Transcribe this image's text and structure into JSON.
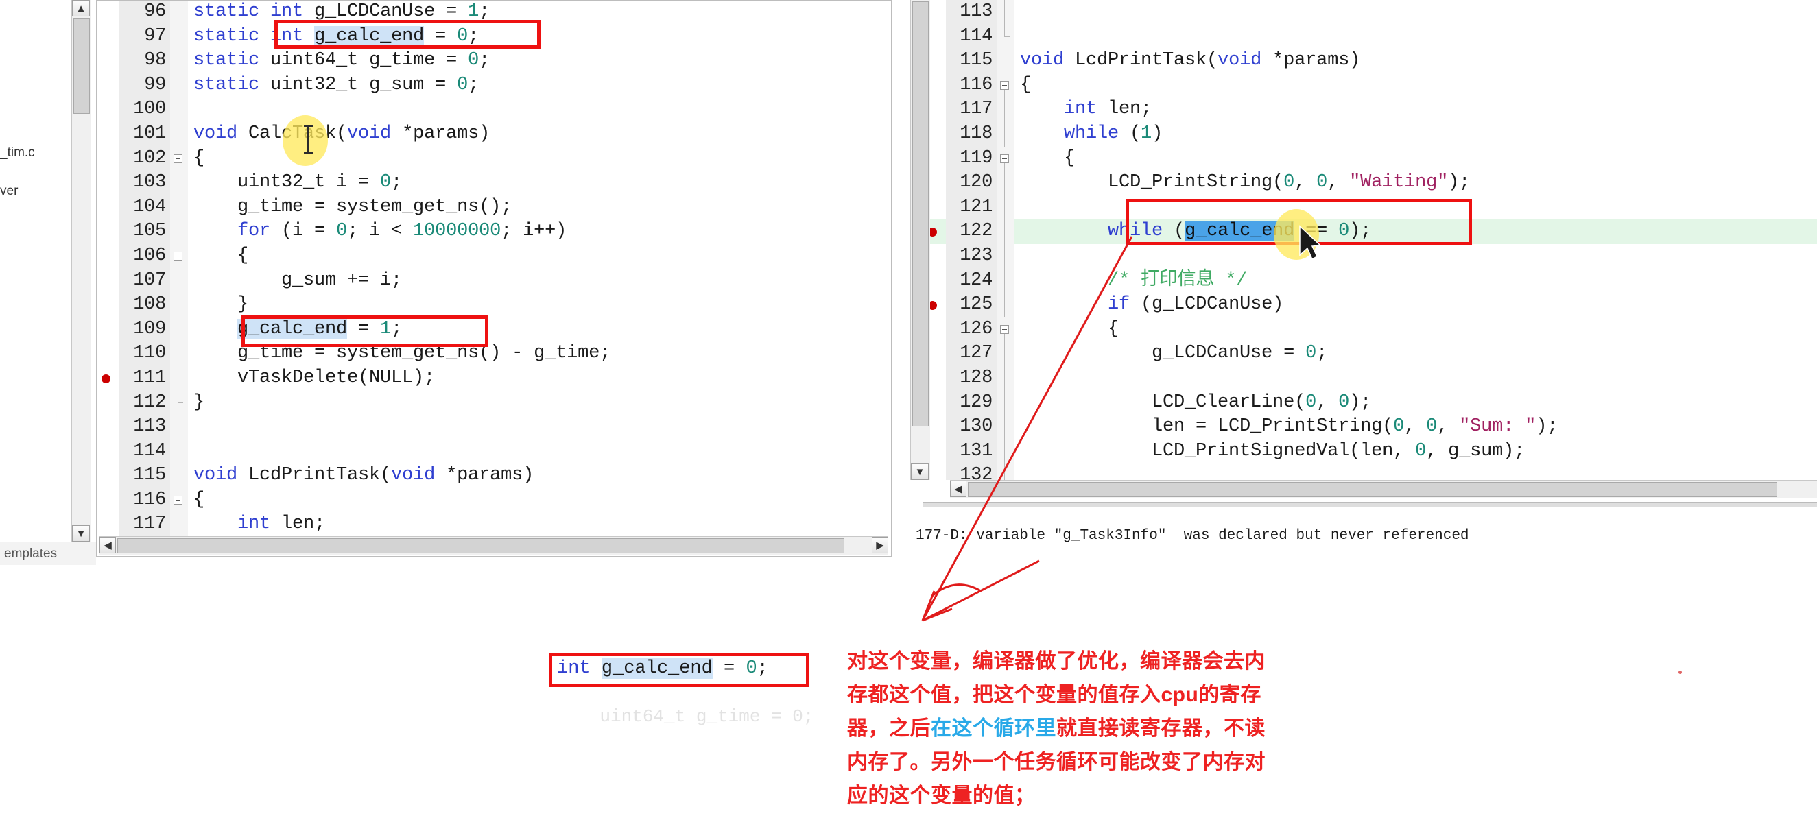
{
  "left_editor": {
    "name": "left-code-editor",
    "lines": [
      {
        "num": "96",
        "fold": "none",
        "bp": false,
        "exec": false,
        "tokens": [
          {
            "t": "static ",
            "c": "kw"
          },
          {
            "t": "int",
            "c": "type"
          },
          {
            "t": " g_LCDCanUse = ",
            "c": "fn"
          },
          {
            "t": "1",
            "c": "num"
          },
          {
            "t": ";",
            "c": "fn"
          }
        ]
      },
      {
        "num": "97",
        "fold": "none",
        "bp": false,
        "exec": false,
        "tokens": [
          {
            "t": "static ",
            "c": "kw"
          },
          {
            "t": "int",
            "c": "type"
          },
          {
            "t": " ",
            "c": "fn"
          },
          {
            "t": "g_calc_end",
            "c": "sel"
          },
          {
            "t": " = ",
            "c": "fn"
          },
          {
            "t": "0",
            "c": "num"
          },
          {
            "t": ";",
            "c": "fn"
          }
        ]
      },
      {
        "num": "98",
        "fold": "none",
        "bp": false,
        "exec": false,
        "tokens": [
          {
            "t": "static ",
            "c": "kw"
          },
          {
            "t": "uint64_t",
            "c": "fn"
          },
          {
            "t": " g_time = ",
            "c": "fn"
          },
          {
            "t": "0",
            "c": "num"
          },
          {
            "t": ";",
            "c": "fn"
          }
        ]
      },
      {
        "num": "99",
        "fold": "none",
        "bp": false,
        "exec": false,
        "tokens": [
          {
            "t": "static ",
            "c": "kw"
          },
          {
            "t": "uint32_t",
            "c": "fn"
          },
          {
            "t": " g_sum = ",
            "c": "fn"
          },
          {
            "t": "0",
            "c": "num"
          },
          {
            "t": ";",
            "c": "fn"
          }
        ]
      },
      {
        "num": "100",
        "fold": "none",
        "bp": false,
        "exec": false,
        "tokens": []
      },
      {
        "num": "101",
        "fold": "none",
        "bp": false,
        "exec": false,
        "tokens": [
          {
            "t": "void",
            "c": "kw"
          },
          {
            "t": " CalcTask(",
            "c": "fn"
          },
          {
            "t": "void",
            "c": "kw"
          },
          {
            "t": " *params)",
            "c": "fn"
          }
        ]
      },
      {
        "num": "102",
        "fold": "open",
        "bp": false,
        "exec": false,
        "tokens": [
          {
            "t": "{",
            "c": "fn"
          }
        ]
      },
      {
        "num": "103",
        "fold": "bar",
        "bp": false,
        "exec": false,
        "tokens": [
          {
            "t": "    uint32_t i = ",
            "c": "fn"
          },
          {
            "t": "0",
            "c": "num"
          },
          {
            "t": ";",
            "c": "fn"
          }
        ]
      },
      {
        "num": "104",
        "fold": "bar",
        "bp": false,
        "exec": false,
        "tokens": [
          {
            "t": "    g_time = system_get_ns();",
            "c": "fn"
          }
        ]
      },
      {
        "num": "105",
        "fold": "bar",
        "bp": false,
        "exec": false,
        "tokens": [
          {
            "t": "    ",
            "c": "fn"
          },
          {
            "t": "for",
            "c": "kw"
          },
          {
            "t": " (i = ",
            "c": "fn"
          },
          {
            "t": "0",
            "c": "num"
          },
          {
            "t": "; i < ",
            "c": "fn"
          },
          {
            "t": "10000000",
            "c": "num"
          },
          {
            "t": "; i++)",
            "c": "fn"
          }
        ]
      },
      {
        "num": "106",
        "fold": "open",
        "bp": false,
        "exec": false,
        "tokens": [
          {
            "t": "    {",
            "c": "fn"
          }
        ]
      },
      {
        "num": "107",
        "fold": "bar",
        "bp": false,
        "exec": false,
        "tokens": [
          {
            "t": "        g_sum += i;",
            "c": "fn"
          }
        ]
      },
      {
        "num": "108",
        "fold": "tick",
        "bp": false,
        "exec": false,
        "tokens": [
          {
            "t": "    }",
            "c": "fn"
          }
        ]
      },
      {
        "num": "109",
        "fold": "bar",
        "bp": false,
        "exec": false,
        "tokens": [
          {
            "t": "    ",
            "c": "fn"
          },
          {
            "t": "g_calc_end",
            "c": "sel"
          },
          {
            "t": " = ",
            "c": "fn"
          },
          {
            "t": "1",
            "c": "num"
          },
          {
            "t": ";",
            "c": "fn"
          }
        ]
      },
      {
        "num": "110",
        "fold": "bar",
        "bp": false,
        "exec": false,
        "tokens": [
          {
            "t": "    g_time = system_get_ns() - g_time;",
            "c": "fn"
          }
        ]
      },
      {
        "num": "111",
        "fold": "bar",
        "bp": true,
        "exec": false,
        "tokens": [
          {
            "t": "    vTaskDelete(NULL);",
            "c": "fn"
          }
        ]
      },
      {
        "num": "112",
        "fold": "end",
        "bp": false,
        "exec": false,
        "tokens": [
          {
            "t": "}",
            "c": "fn"
          }
        ]
      },
      {
        "num": "113",
        "fold": "none",
        "bp": false,
        "exec": false,
        "tokens": []
      },
      {
        "num": "114",
        "fold": "none",
        "bp": false,
        "exec": false,
        "tokens": []
      },
      {
        "num": "115",
        "fold": "none",
        "bp": false,
        "exec": false,
        "tokens": [
          {
            "t": "void",
            "c": "kw"
          },
          {
            "t": " LcdPrintTask(",
            "c": "fn"
          },
          {
            "t": "void",
            "c": "kw"
          },
          {
            "t": " *params)",
            "c": "fn"
          }
        ]
      },
      {
        "num": "116",
        "fold": "open",
        "bp": false,
        "exec": false,
        "tokens": [
          {
            "t": "{",
            "c": "fn"
          }
        ]
      },
      {
        "num": "117",
        "fold": "bar",
        "bp": false,
        "exec": false,
        "tokens": [
          {
            "t": "    ",
            "c": "fn"
          },
          {
            "t": "int",
            "c": "type"
          },
          {
            "t": " len;",
            "c": "fn"
          }
        ]
      }
    ]
  },
  "right_editor": {
    "name": "right-code-editor",
    "lines": [
      {
        "num": "113",
        "fold": "bar",
        "bp": false,
        "exec": false,
        "tokens": []
      },
      {
        "num": "114",
        "fold": "end",
        "bp": false,
        "exec": false,
        "tokens": []
      },
      {
        "num": "115",
        "fold": "none",
        "bp": false,
        "exec": false,
        "tokens": [
          {
            "t": "void",
            "c": "kw"
          },
          {
            "t": " LcdPrintTask(",
            "c": "fn"
          },
          {
            "t": "void",
            "c": "kw"
          },
          {
            "t": " *params)",
            "c": "fn"
          }
        ]
      },
      {
        "num": "116",
        "fold": "open",
        "bp": false,
        "exec": false,
        "tokens": [
          {
            "t": "{",
            "c": "fn"
          }
        ]
      },
      {
        "num": "117",
        "fold": "bar",
        "bp": false,
        "exec": false,
        "tokens": [
          {
            "t": "    ",
            "c": "fn"
          },
          {
            "t": "int",
            "c": "type"
          },
          {
            "t": " len;",
            "c": "fn"
          }
        ]
      },
      {
        "num": "118",
        "fold": "bar",
        "bp": false,
        "exec": false,
        "tokens": [
          {
            "t": "    ",
            "c": "fn"
          },
          {
            "t": "while",
            "c": "kw"
          },
          {
            "t": " (",
            "c": "fn"
          },
          {
            "t": "1",
            "c": "num"
          },
          {
            "t": ")",
            "c": "fn"
          }
        ]
      },
      {
        "num": "119",
        "fold": "open",
        "bp": false,
        "exec": false,
        "tokens": [
          {
            "t": "    {",
            "c": "fn"
          }
        ]
      },
      {
        "num": "120",
        "fold": "bar",
        "bp": false,
        "exec": false,
        "tokens": [
          {
            "t": "        LCD_PrintString(",
            "c": "fn"
          },
          {
            "t": "0",
            "c": "num"
          },
          {
            "t": ", ",
            "c": "fn"
          },
          {
            "t": "0",
            "c": "num"
          },
          {
            "t": ", ",
            "c": "fn"
          },
          {
            "t": "\"Waiting\"",
            "c": "str"
          },
          {
            "t": ");",
            "c": "fn"
          }
        ]
      },
      {
        "num": "121",
        "fold": "bar",
        "bp": false,
        "exec": false,
        "tokens": []
      },
      {
        "num": "122",
        "fold": "bar",
        "bp": true,
        "exec": true,
        "tokens": [
          {
            "t": "        ",
            "c": "fn"
          },
          {
            "t": "while",
            "c": "kw"
          },
          {
            "t": " (",
            "c": "fn"
          },
          {
            "t": "g_calc_end",
            "c": "sel-strong"
          },
          {
            "t": " == ",
            "c": "fn"
          },
          {
            "t": "0",
            "c": "num"
          },
          {
            "t": ");",
            "c": "fn"
          }
        ]
      },
      {
        "num": "123",
        "fold": "bar",
        "bp": false,
        "exec": false,
        "tokens": []
      },
      {
        "num": "124",
        "fold": "bar",
        "bp": false,
        "exec": false,
        "tokens": [
          {
            "t": "        ",
            "c": "fn"
          },
          {
            "t": "/* 打印信息 */",
            "c": "cmt"
          }
        ]
      },
      {
        "num": "125",
        "fold": "bar",
        "bp": true,
        "exec": false,
        "tokens": [
          {
            "t": "        ",
            "c": "fn"
          },
          {
            "t": "if",
            "c": "kw"
          },
          {
            "t": " (g_LCDCanUse)",
            "c": "fn"
          }
        ]
      },
      {
        "num": "126",
        "fold": "open",
        "bp": false,
        "exec": false,
        "tokens": [
          {
            "t": "        {",
            "c": "fn"
          }
        ]
      },
      {
        "num": "127",
        "fold": "bar",
        "bp": false,
        "exec": false,
        "tokens": [
          {
            "t": "            g_LCDCanUse = ",
            "c": "fn"
          },
          {
            "t": "0",
            "c": "num"
          },
          {
            "t": ";",
            "c": "fn"
          }
        ]
      },
      {
        "num": "128",
        "fold": "bar",
        "bp": false,
        "exec": false,
        "tokens": []
      },
      {
        "num": "129",
        "fold": "bar",
        "bp": false,
        "exec": false,
        "tokens": [
          {
            "t": "            LCD_ClearLine(",
            "c": "fn"
          },
          {
            "t": "0",
            "c": "num"
          },
          {
            "t": ", ",
            "c": "fn"
          },
          {
            "t": "0",
            "c": "num"
          },
          {
            "t": ");",
            "c": "fn"
          }
        ]
      },
      {
        "num": "130",
        "fold": "bar",
        "bp": false,
        "exec": false,
        "tokens": [
          {
            "t": "            len = LCD_PrintString(",
            "c": "fn"
          },
          {
            "t": "0",
            "c": "num"
          },
          {
            "t": ", ",
            "c": "fn"
          },
          {
            "t": "0",
            "c": "num"
          },
          {
            "t": ", ",
            "c": "fn"
          },
          {
            "t": "\"Sum: \"",
            "c": "str"
          },
          {
            "t": ");",
            "c": "fn"
          }
        ]
      },
      {
        "num": "131",
        "fold": "bar",
        "bp": false,
        "exec": false,
        "tokens": [
          {
            "t": "            LCD_PrintSignedVal(len, ",
            "c": "fn"
          },
          {
            "t": "0",
            "c": "num"
          },
          {
            "t": ", g_sum);",
            "c": "fn"
          }
        ]
      },
      {
        "num": "132",
        "fold": "bar",
        "bp": false,
        "exec": false,
        "tokens": []
      }
    ],
    "status_message": "177-D: variable \"g_Task3Info\"  was declared but never referenced"
  },
  "explorer": {
    "items": [
      {
        "label": "_tim.c"
      },
      {
        "label": "ver"
      }
    ],
    "tab_label": "emplates"
  },
  "snippet_box": {
    "name": "zoomed-code-snippet",
    "tokens": [
      {
        "t": "int",
        "c": "type"
      },
      {
        "t": " ",
        "c": "fn"
      },
      {
        "t": "g_calc_end",
        "c": "sel"
      },
      {
        "t": " = ",
        "c": "fn"
      },
      {
        "t": "0",
        "c": "num"
      },
      {
        "t": ";",
        "c": "fn"
      }
    ],
    "ghost_line": "uint64_t g_time = 0;"
  },
  "annotation": {
    "name": "chinese-annotation",
    "segments": [
      {
        "text": "对这个变量，编译器做了优化，编译器会去内存都这个值，把这个变量的值存入cpu的寄存器，之后",
        "highlight": false
      },
      {
        "text": "在这个循环里",
        "highlight": true
      },
      {
        "text": "就直接读寄存器，不读内存了。另外一个任务循环可能改变了内存对应的这个变量的值；",
        "highlight": false
      }
    ]
  },
  "colors": {
    "annotation_red": "#ee2222",
    "annotation_blue": "#29a9e8",
    "highlight_box_red": "#ee1111",
    "breakpoint_red": "#cc0000",
    "exec_line_green": "#e3f6e7",
    "selection_blue": "#4aa3e8",
    "soft_selection": "#cfe3f7",
    "cursor_blob_yellow": "#ffe95e"
  }
}
